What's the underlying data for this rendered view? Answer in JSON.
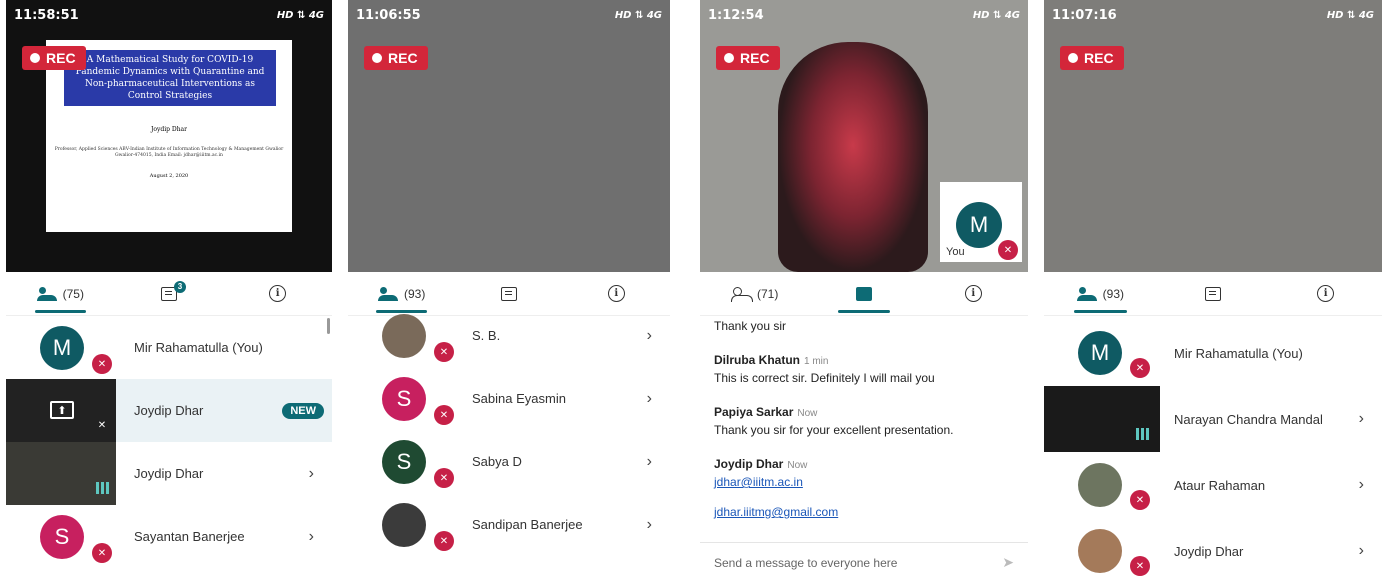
{
  "screens": [
    {
      "time": "11:58:51",
      "status_right": "HD ⇅ 4G",
      "rec": "REC",
      "slide": {
        "title": "A Mathematical Study for COVID-19 Pandemic Dynamics with Quarantine and Non-pharmaceutical Interventions as Control Strategies",
        "author": "Joydip Dhar",
        "affiliation": "Professor, Applied Sciences ABV-Indian Institute of Information Technology & Management Gwalior Gwalior-474015, India Email: jdhar@iiitm.ac.in",
        "date": "August 2, 2020"
      },
      "tabs": {
        "people_count": "(75)",
        "chat_badge": "3"
      },
      "participants": [
        {
          "avatar": "M",
          "name": "Mir Rahamatulla (You)"
        },
        {
          "name": "Joydip Dhar",
          "tag": "NEW"
        },
        {
          "name": "Joydip Dhar"
        },
        {
          "avatar": "S",
          "name": "Sayantan Banerjee"
        }
      ]
    },
    {
      "time": "11:06:55",
      "status_right": "HD ⇅ 4G",
      "rec": "REC",
      "tabs": {
        "people_count": "(93)"
      },
      "participants": [
        {
          "name": "S. B."
        },
        {
          "avatar": "S",
          "name": "Sabina Eyasmin"
        },
        {
          "avatar": "S",
          "name": "Sabya D"
        },
        {
          "name": "Sandipan Banerjee"
        }
      ]
    },
    {
      "time": "1:12:54",
      "status_right": "HD ⇅ 4G",
      "rec": "REC",
      "self_avatar": "M",
      "self_label": "You",
      "tabs": {
        "people_count": "(71)"
      },
      "messages": [
        {
          "text": "Thank you sir"
        },
        {
          "sender": "Dilruba Khatun",
          "when": "1 min",
          "text": "This is correct  sir. Definitely  I will mail you"
        },
        {
          "sender": "Papiya Sarkar",
          "when": "Now",
          "text": "Thank you sir for your excellent presentation."
        },
        {
          "sender": "Joydip Dhar",
          "when": "Now",
          "link1": "jdhar@iiitm.ac.in",
          "link2": "jdhar.iiitmg@gmail.com"
        }
      ],
      "composer_placeholder": "Send a message to everyone here"
    },
    {
      "time": "11:07:16",
      "status_right": "HD ⇅ 4G",
      "rec": "REC",
      "tabs": {
        "people_count": "(93)"
      },
      "participants": [
        {
          "avatar": "M",
          "name": "Mir Rahamatulla (You)"
        },
        {
          "name": "Narayan Chandra Mandal"
        },
        {
          "name": "Ataur Rahaman"
        },
        {
          "name": "Joydip Dhar"
        }
      ]
    }
  ]
}
